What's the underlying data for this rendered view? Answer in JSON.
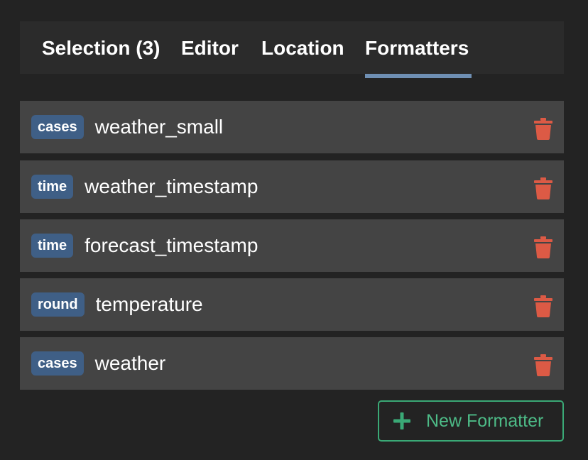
{
  "tabs": [
    {
      "label": "Selection (3)",
      "active": false
    },
    {
      "label": "Editor",
      "active": false
    },
    {
      "label": "Location",
      "active": false
    },
    {
      "label": "Formatters",
      "active": true
    }
  ],
  "formatters": [
    {
      "type": "cases",
      "name": "weather_small"
    },
    {
      "type": "time",
      "name": "weather_timestamp"
    },
    {
      "type": "time",
      "name": "forecast_timestamp"
    },
    {
      "type": "round",
      "name": "temperature"
    },
    {
      "type": "cases",
      "name": "weather"
    }
  ],
  "row_actions": {
    "delete_icon": "trash-icon"
  },
  "new_formatter": {
    "label": "New Formatter",
    "icon": "plus-icon"
  },
  "colors": {
    "accent": "#6f8fb3",
    "badge": "#3f5f86",
    "delete": "#dc5a45",
    "success": "#3aa976"
  }
}
